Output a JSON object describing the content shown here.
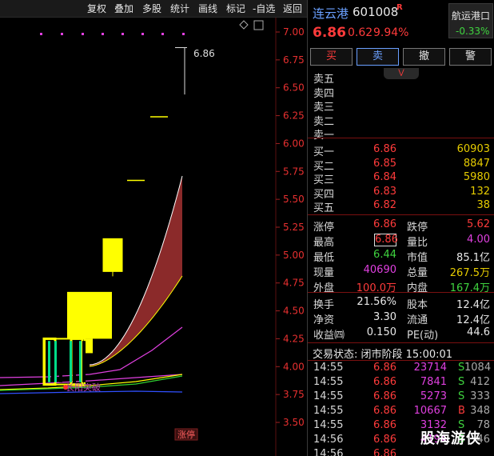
{
  "toolbar": {
    "buttons": [
      "复权",
      "叠加",
      "多股",
      "统计",
      "画线",
      "标记",
      "-自选",
      "返回"
    ]
  },
  "chart": {
    "y_ticks": [
      "7.00",
      "6.75",
      "6.50",
      "6.25",
      "6.00",
      "5.75",
      "5.50",
      "5.25",
      "5.00",
      "4.75",
      "4.50",
      "4.25",
      "4.00",
      "3.75",
      "3.50"
    ],
    "high_marker": "6.86",
    "signal_label": "涨停",
    "wave_label": "长阳突破",
    "colors": {
      "up": "#ffff00",
      "band_fill": "#8b2a2a",
      "band_edge": "#ffffff",
      "ma_yellow": "#ffff00",
      "ma_magenta": "#e040e0",
      "ma_green": "#30d030",
      "ma_blue": "#3050ff",
      "grid": "#7a1010",
      "dots": "#e040e0"
    }
  },
  "chart_data": {
    "type": "candlestick",
    "title": "",
    "ylim": [
      3.5,
      7.0
    ],
    "candles": [
      {
        "open": 3.84,
        "close": 4.25,
        "high": 4.25,
        "low": 3.84
      },
      {
        "open": 3.84,
        "close": 4.25,
        "high": 4.25,
        "low": 3.84
      },
      {
        "open": 4.25,
        "close": 4.67,
        "high": 4.67,
        "low": 4.29
      },
      {
        "open": 4.86,
        "close": 5.14,
        "high": 5.14,
        "low": 4.86
      },
      {
        "open": 5.67,
        "close": 5.67,
        "high": 5.67,
        "low": 5.67
      },
      {
        "open": 6.24,
        "close": 6.24,
        "high": 6.24,
        "low": 6.24
      },
      {
        "open": 6.86,
        "close": 6.86,
        "high": 6.86,
        "low": 6.44
      }
    ]
  },
  "quote": {
    "name": "连云港",
    "code": "601008",
    "flag": "R",
    "price": "6.86",
    "change": "0.62",
    "change_pct": "9.94%",
    "sector": {
      "name": "航运港口",
      "pct": "-0.33%"
    },
    "buttons": [
      "买",
      "卖",
      "撤",
      "警"
    ],
    "sell_labels": [
      "卖五",
      "卖四",
      "卖三",
      "卖二",
      "卖一"
    ],
    "buy_book": [
      {
        "label": "买一",
        "price": "6.86",
        "vol": "60903"
      },
      {
        "label": "买二",
        "price": "6.85",
        "vol": "8847"
      },
      {
        "label": "买三",
        "price": "6.84",
        "vol": "5980"
      },
      {
        "label": "买四",
        "price": "6.83",
        "vol": "132"
      },
      {
        "label": "买五",
        "price": "6.82",
        "vol": "38"
      }
    ],
    "stats1": [
      {
        "l1": "涨停",
        "v1": "6.86",
        "l2": "跌停",
        "v2": "5.62"
      },
      {
        "l1": "最高",
        "v1": "6.86",
        "l2": "量比",
        "v2": "4.00"
      },
      {
        "l1": "最低",
        "v1": "6.44",
        "l2": "市值",
        "v2": "85.1亿"
      },
      {
        "l1": "现量",
        "v1": "40690",
        "l2": "总量",
        "v2": "267.5万"
      },
      {
        "l1": "外盘",
        "v1": "100.0万",
        "l2": "内盘",
        "v2": "167.4万"
      }
    ],
    "stats2": [
      {
        "l1": "换手",
        "v1": "21.56%",
        "l2": "股本",
        "v2": "12.4亿"
      },
      {
        "l1": "净资",
        "v1": "3.30",
        "l2": "流通",
        "v2": "12.4亿"
      },
      {
        "l1": "收益㈣",
        "v1": "0.150",
        "l2": "PE(动)",
        "v2": "44.6"
      }
    ],
    "trade_status": "交易状态: 闭市阶段 15:00:01",
    "ticks": [
      {
        "time": "14:55",
        "price": "6.86",
        "vol": "23714",
        "side": "S",
        "n": "1084"
      },
      {
        "time": "14:55",
        "price": "6.86",
        "vol": "7841",
        "side": "S",
        "n": "412"
      },
      {
        "time": "14:55",
        "price": "6.86",
        "vol": "5273",
        "side": "S",
        "n": "333"
      },
      {
        "time": "14:55",
        "price": "6.86",
        "vol": "10667",
        "side": "B",
        "n": "348"
      },
      {
        "time": "14:55",
        "price": "6.86",
        "vol": "3132",
        "side": "S",
        "n": "78"
      },
      {
        "time": "14:56",
        "price": "6.86",
        "vol": "4194",
        "side": "S",
        "n": "46"
      },
      {
        "time": "14:56",
        "price": "6.86",
        "vol": "",
        "side": "",
        "n": ""
      }
    ]
  },
  "watermark": "股海游侠"
}
